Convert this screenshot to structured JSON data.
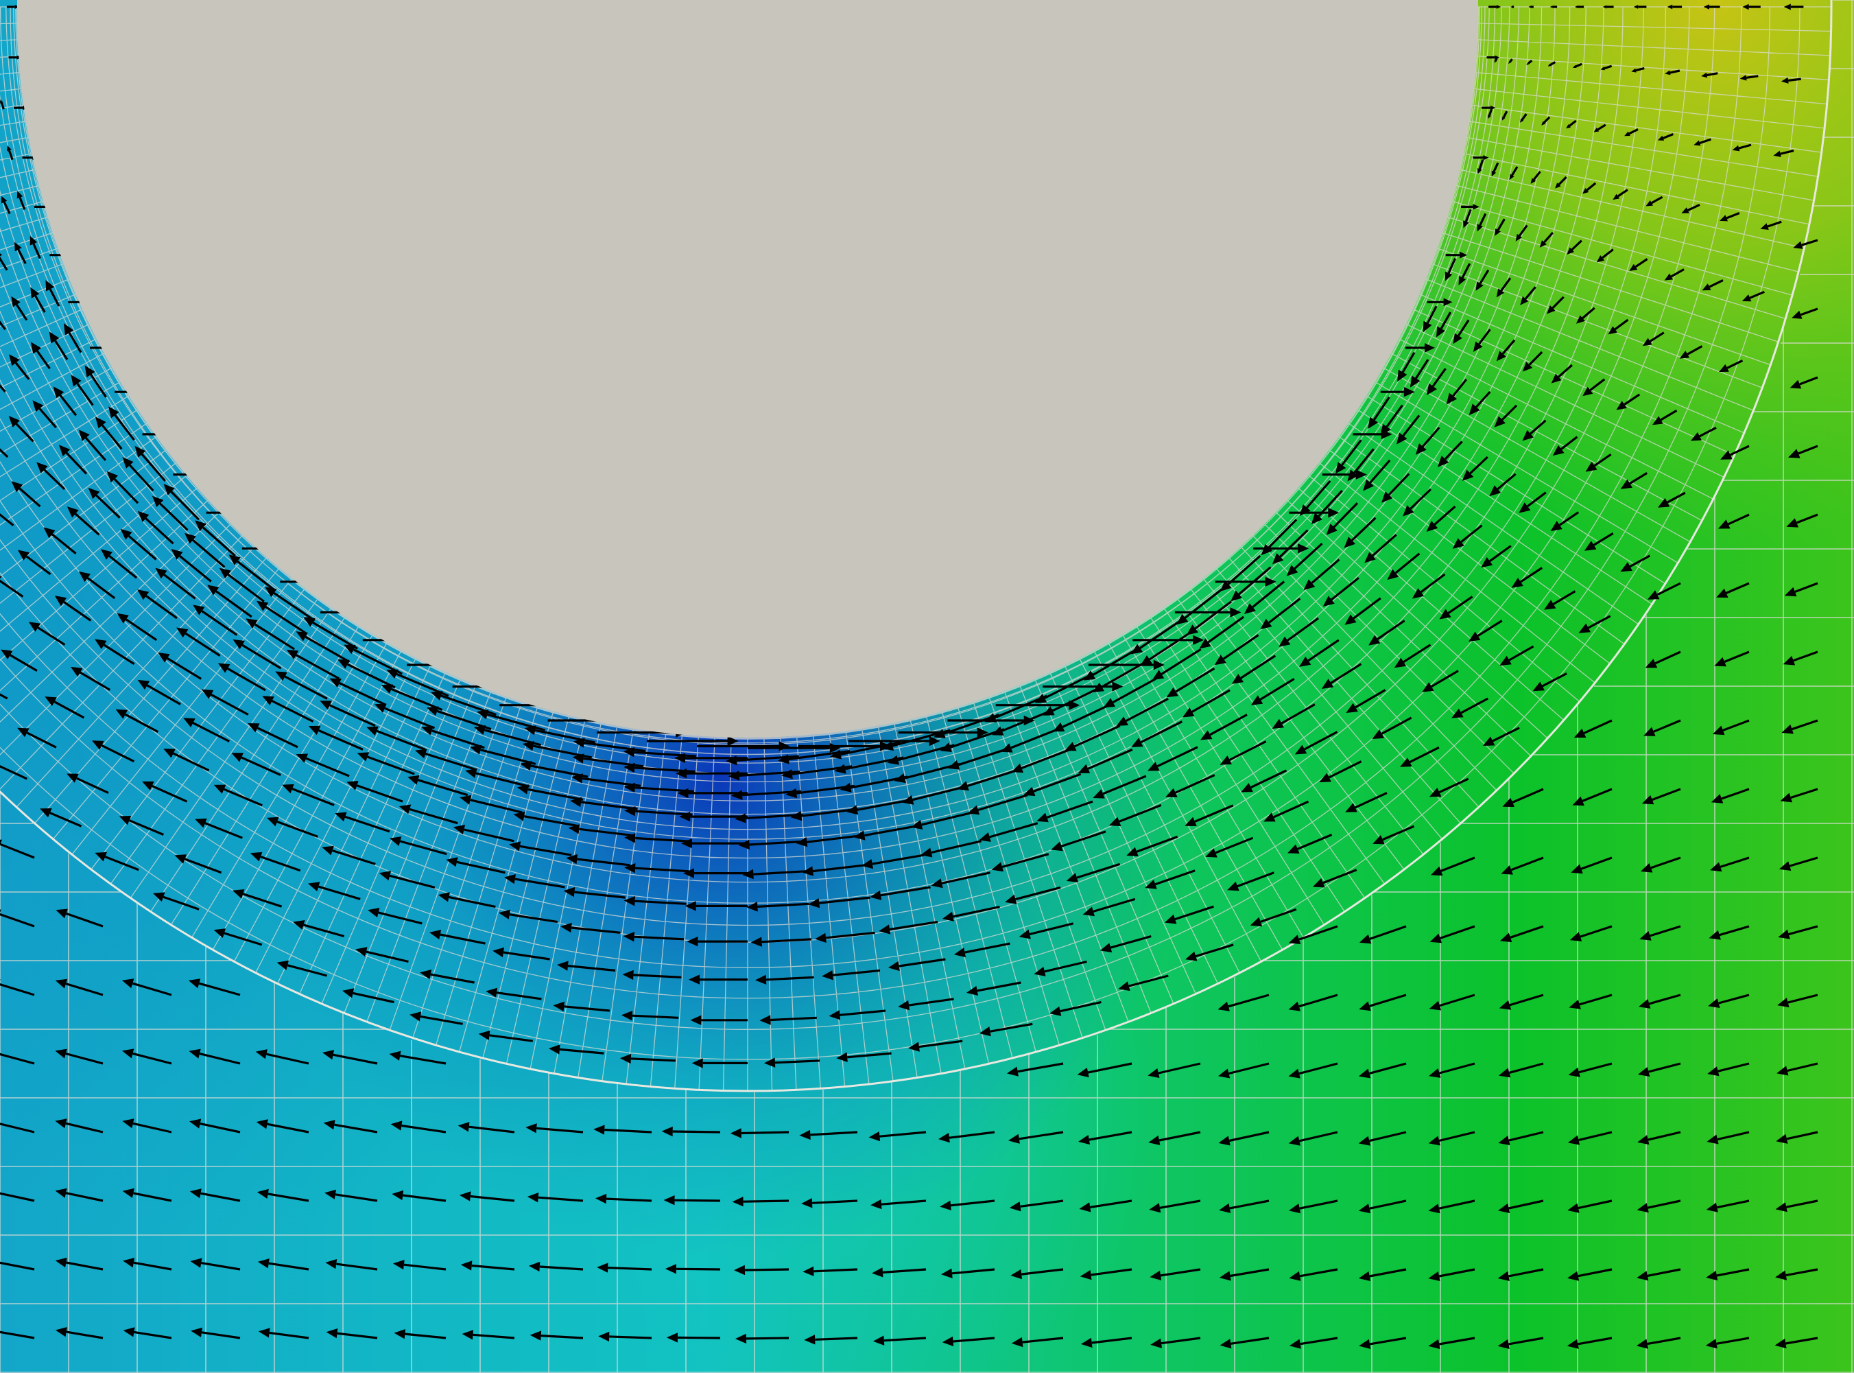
{
  "scene": {
    "kind": "cfd-velocity-field",
    "obstacle": "cylinder",
    "mesh": {
      "outer_grid": "cartesian",
      "near_wall": "o-grid-refined"
    },
    "glyphs": "velocity-arrows",
    "colormap": [
      "#0a2fb8",
      "#0d7fc4",
      "#12c7c0",
      "#0fc13a",
      "#7fc81a",
      "#c7c315"
    ]
  },
  "colors": {
    "obstacle_fill": "#c8c5bd",
    "grid_line": "#d9dbd4",
    "ring_boundary": "#e8e8e0",
    "arrow": "#000000"
  }
}
